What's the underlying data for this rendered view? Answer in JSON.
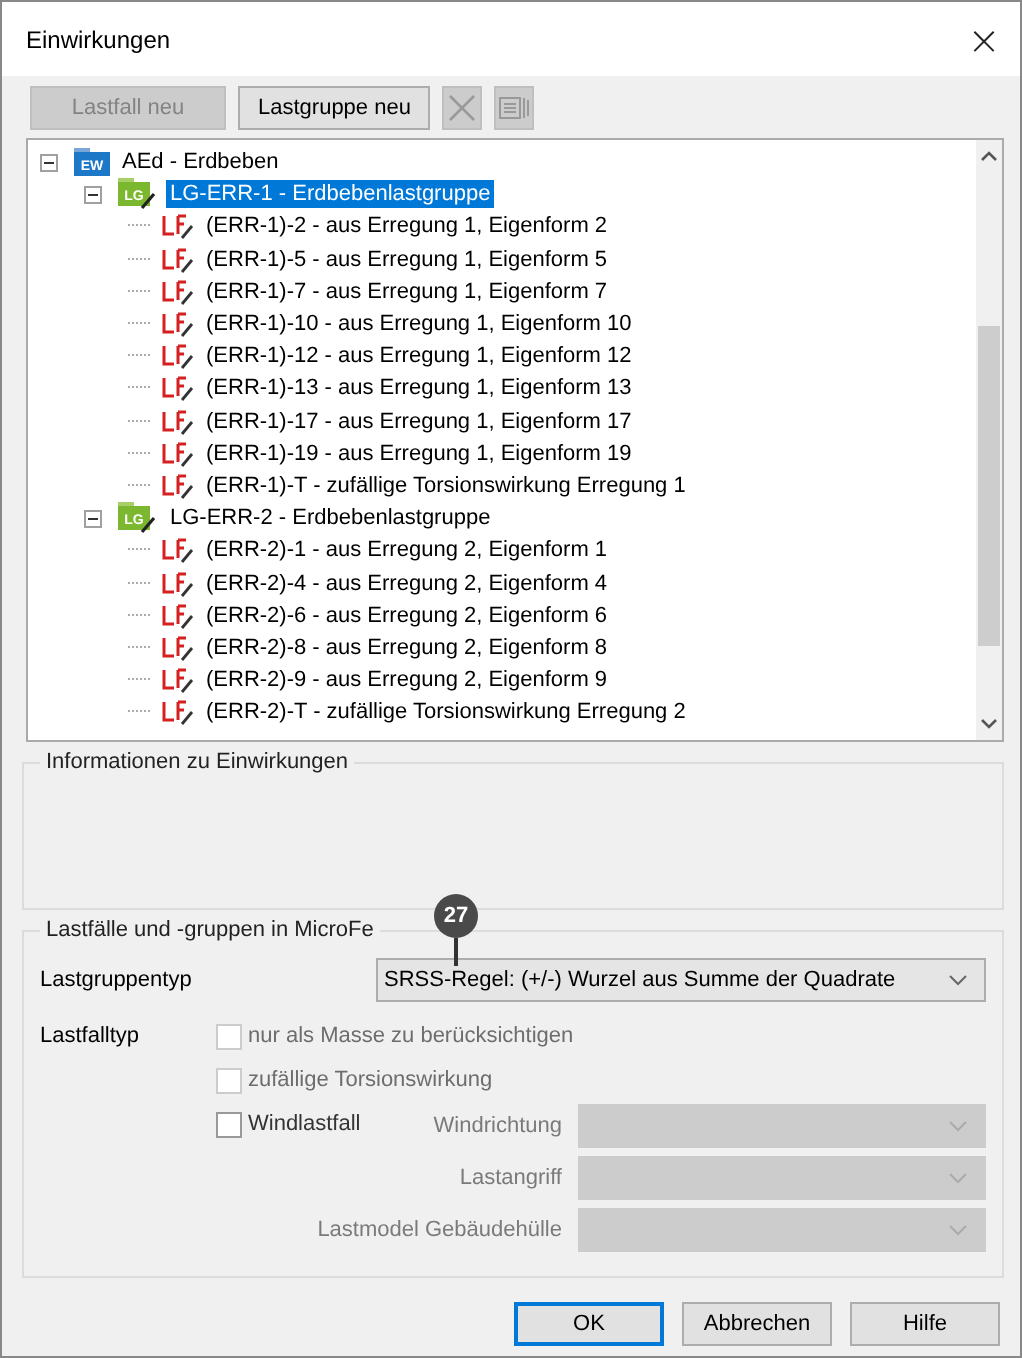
{
  "window": {
    "title": "Einwirkungen",
    "close": "×"
  },
  "toolbar": [
    {
      "kind": "text",
      "label": "Lastfall neu",
      "disabled": true
    },
    {
      "kind": "text",
      "label": "Lastgruppe neu",
      "disabled": false
    },
    {
      "kind": "delete",
      "disabled": true
    },
    {
      "kind": "list",
      "disabled": true
    }
  ],
  "tree": [
    {
      "kind": "ew",
      "icon_text": "EW",
      "label": "AEd - Erdbeben",
      "expanded": true,
      "selected": false,
      "children": [
        {
          "kind": "lg",
          "icon_text": "LG",
          "label": "LG-ERR-1 - Erdbebenlastgruppe",
          "expanded": true,
          "selected": true,
          "children": [
            {
              "kind": "lf",
              "label": "(ERR-1)-2 - aus Erregung 1, Eigenform 2",
              "selected": false
            },
            {
              "kind": "lf",
              "label": "(ERR-1)-5 - aus Erregung 1, Eigenform 5",
              "selected": false
            },
            {
              "kind": "lf",
              "label": "(ERR-1)-7 - aus Erregung 1, Eigenform 7",
              "selected": false
            },
            {
              "kind": "lf",
              "label": "(ERR-1)-10 - aus Erregung 1, Eigenform 10",
              "selected": false
            },
            {
              "kind": "lf",
              "label": "(ERR-1)-12 - aus Erregung 1, Eigenform 12",
              "selected": false
            },
            {
              "kind": "lf",
              "label": "(ERR-1)-13 - aus Erregung 1, Eigenform 13",
              "selected": false
            },
            {
              "kind": "lf",
              "label": "(ERR-1)-17 - aus Erregung 1, Eigenform 17",
              "selected": false
            },
            {
              "kind": "lf",
              "label": "(ERR-1)-19 - aus Erregung 1, Eigenform 19",
              "selected": false
            },
            {
              "kind": "lf",
              "label": "(ERR-1)-T - zufällige Torsionswirkung Erregung 1",
              "selected": false
            }
          ]
        },
        {
          "kind": "lg",
          "icon_text": "LG",
          "label": "LG-ERR-2 - Erdbebenlastgruppe",
          "expanded": true,
          "selected": false,
          "children": [
            {
              "kind": "lf",
              "label": "(ERR-2)-1 - aus Erregung 2, Eigenform 1",
              "selected": false
            },
            {
              "kind": "lf",
              "label": "(ERR-2)-4 - aus Erregung 2, Eigenform 4",
              "selected": false
            },
            {
              "kind": "lf",
              "label": "(ERR-2)-6 - aus Erregung 2, Eigenform 6",
              "selected": false
            },
            {
              "kind": "lf",
              "label": "(ERR-2)-8 - aus Erregung 2, Eigenform 8",
              "selected": false
            },
            {
              "kind": "lf",
              "label": "(ERR-2)-9 - aus Erregung 2, Eigenform 9",
              "selected": false
            },
            {
              "kind": "lf",
              "label": "(ERR-2)-T - zufällige Torsionswirkung Erregung 2",
              "selected": false
            }
          ]
        }
      ]
    }
  ],
  "info_group": {
    "title": "Informationen zu Einwirkungen"
  },
  "microfe_group": {
    "title": "Lastfälle und -gruppen in MicroFe",
    "callout": "27",
    "lastgruppentyp": {
      "label": "Lastgruppentyp",
      "value": "SRSS-Regel: (+/-) Wurzel aus Summe der Quadrate",
      "disabled": false
    },
    "lastfalltyp": {
      "label": "Lastfalltyp",
      "options": [
        {
          "label": "nur als Masse zu berücksichtigen",
          "checked": false,
          "disabled": true
        },
        {
          "label": "zufällige Torsionswirkung",
          "checked": false,
          "disabled": true
        },
        {
          "label": "Windlastfall",
          "checked": false,
          "disabled": false
        }
      ]
    },
    "wind_fields": [
      {
        "label": "Windrichtung",
        "disabled": true
      },
      {
        "label": "Lastangriff",
        "disabled": true
      },
      {
        "label": "Lastmodel Gebäudehülle",
        "disabled": true
      }
    ]
  },
  "buttons": [
    {
      "label": "OK",
      "default": true
    },
    {
      "label": "Abbrechen",
      "default": false
    },
    {
      "label": "Hilfe",
      "default": false
    }
  ]
}
